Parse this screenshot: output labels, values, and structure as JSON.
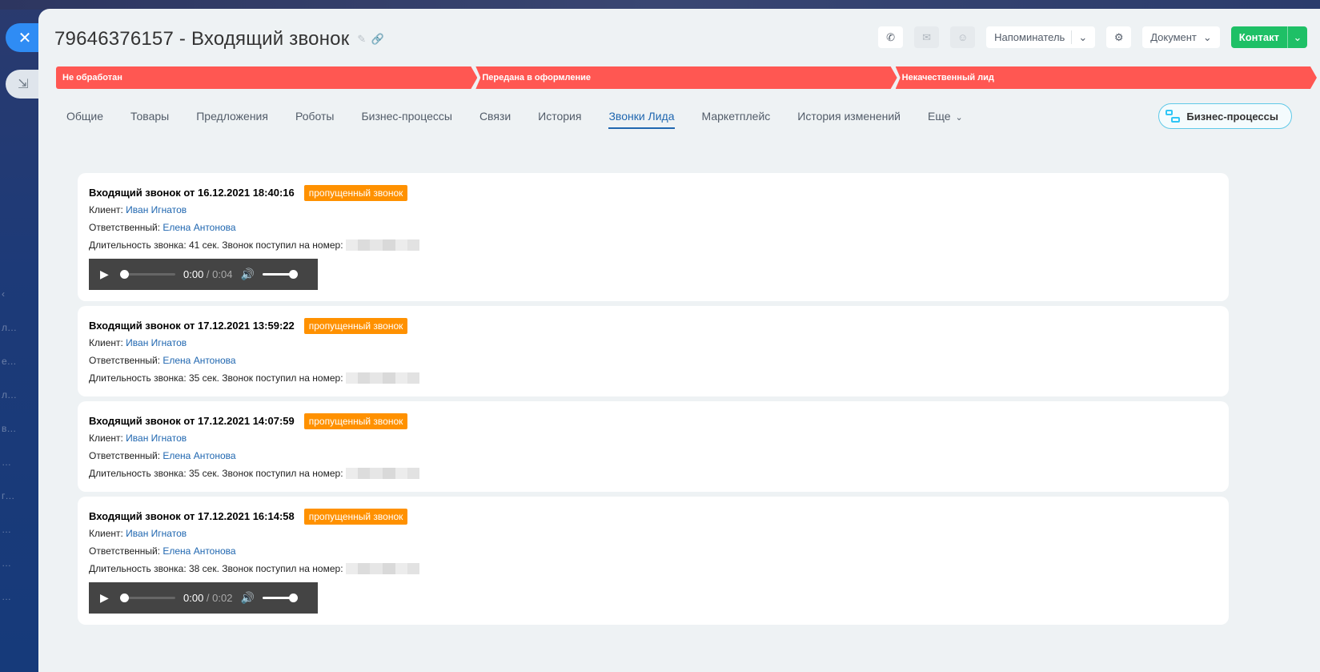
{
  "window": {
    "title": "79646376157 - Входящий звонок"
  },
  "header": {
    "reminder_label": "Напоминатель",
    "document_label": "Документ",
    "contact_label": "Контакт"
  },
  "stages": [
    {
      "label": "Не обработан"
    },
    {
      "label": "Передана в оформление"
    },
    {
      "label": "Некачественный лид"
    }
  ],
  "colors": {
    "stage": "#ff5752",
    "accent_green": "#1ec066",
    "badge": "#ff9100",
    "link": "#2067b0"
  },
  "tabs": [
    {
      "label": "Общие"
    },
    {
      "label": "Товары"
    },
    {
      "label": "Предложения"
    },
    {
      "label": "Роботы"
    },
    {
      "label": "Бизнес-процессы"
    },
    {
      "label": "Связи"
    },
    {
      "label": "История"
    },
    {
      "label": "Звонки Лида",
      "active": true
    },
    {
      "label": "Маркетплейс"
    },
    {
      "label": "История изменений"
    },
    {
      "label": "Еще"
    }
  ],
  "bp_button_label": "Бизнес-процессы",
  "labels": {
    "client": "Клиент: ",
    "responsible": "Ответственный: ",
    "number_label": " Звонок поступил на номер: "
  },
  "calls": [
    {
      "title": "Входящий звонок от 16.12.2021 18:40:16",
      "badge": "пропущенный звонок",
      "client": "Иван Игнатов",
      "responsible": "Елена Антонова",
      "duration": "Длительность звонка: 41 сек.",
      "player": {
        "current": "0:00",
        "total": " / 0:04"
      }
    },
    {
      "title": "Входящий звонок от 17.12.2021 13:59:22",
      "badge": "пропущенный звонок",
      "client": "Иван Игнатов",
      "responsible": "Елена Антонова",
      "duration": "Длительность звонка: 35 сек."
    },
    {
      "title": "Входящий звонок от 17.12.2021 14:07:59",
      "badge": "пропущенный звонок",
      "client": "Иван Игнатов",
      "responsible": "Елена Антонова",
      "duration": "Длительность звонка: 35 сек."
    },
    {
      "title": "Входящий звонок от 17.12.2021 16:14:58",
      "badge": "пропущенный звонок",
      "client": "Иван Игнатов",
      "responsible": "Елена Антонова",
      "duration": "Длительность звонка: 38 сек.",
      "player": {
        "current": "0:00",
        "total": " / 0:02"
      }
    }
  ]
}
